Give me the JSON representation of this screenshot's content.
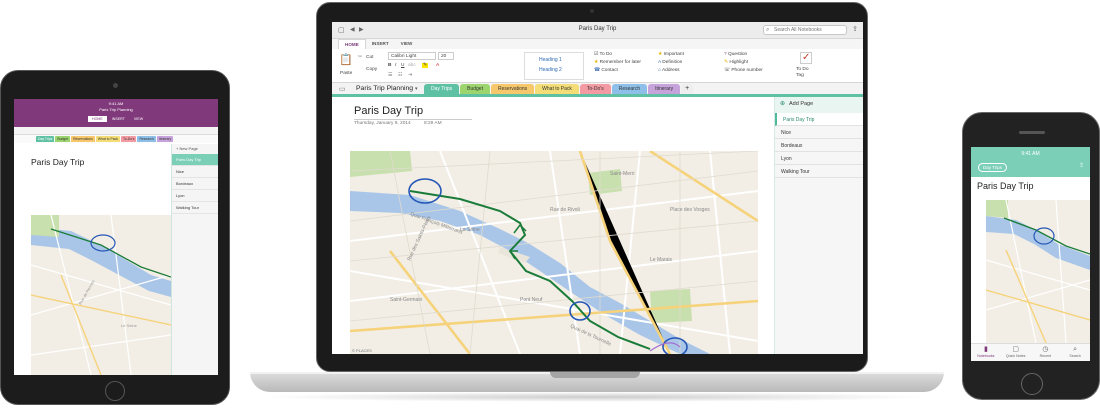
{
  "tablet": {
    "status_time": "9:41 AM",
    "notebook_title": "Paris Trip Planning",
    "ribbon_tabs": [
      "HOME",
      "INSERT",
      "VIEW"
    ],
    "sections": [
      "Day Trips",
      "Budget",
      "Reservations",
      "What to Pack",
      "To-Do's",
      "Research",
      "Itinerary"
    ],
    "add_page": "+ New Page",
    "pages": [
      "Paris Day Trip",
      "Nice",
      "Bordeaux",
      "Lyon",
      "Walking Tour"
    ],
    "page_title": "Paris Day Trip"
  },
  "laptop": {
    "window_title": "Paris Day Trip",
    "search_placeholder": "Search All Notebooks",
    "ribbon_tabs": [
      "HOME",
      "INSERT",
      "VIEW"
    ],
    "ribbon": {
      "paste": "Paste",
      "cut": "Cut",
      "copy": "Copy",
      "font": "Calibri Light",
      "size": "20",
      "styles": [
        "Heading 1",
        "Heading 2"
      ],
      "tags": [
        "To Do",
        "Remember for later",
        "Contact",
        "Important",
        "Definition",
        "Address",
        "Question",
        "Highlight",
        "Phone number"
      ],
      "todo_tag": "To Do Tag"
    },
    "notebook_name": "Paris Trip Planning",
    "sections": [
      "Day Trips",
      "Budget",
      "Reservations",
      "What to Pack",
      "To-Do's",
      "Research",
      "Itinerary"
    ],
    "add_section": "+",
    "add_page": "Add Page",
    "pages": [
      "Paris Day Trip",
      "Nice",
      "Bordeaux",
      "Lyon",
      "Walking Tour"
    ],
    "page_title": "Paris Day Trip",
    "page_date": "Thursday, January 9, 2014",
    "page_time": "8:29 AM",
    "map_label": "© PLACES"
  },
  "phone": {
    "status_time": "9:41 AM",
    "section_pill": "Day Trips",
    "page_title": "Paris Day Trip",
    "tab_bar": [
      "Notebooks",
      "Quick Notes",
      "Recent",
      "Search"
    ]
  },
  "colors": {
    "onenote_purple": "#80397b",
    "accent_teal": "#7ccfb7",
    "section_colors": [
      "#5fc1a4",
      "#9cd56e",
      "#f6c86b",
      "#f4dd77",
      "#f39aa2",
      "#8ebfe8",
      "#c7a3dc"
    ]
  }
}
